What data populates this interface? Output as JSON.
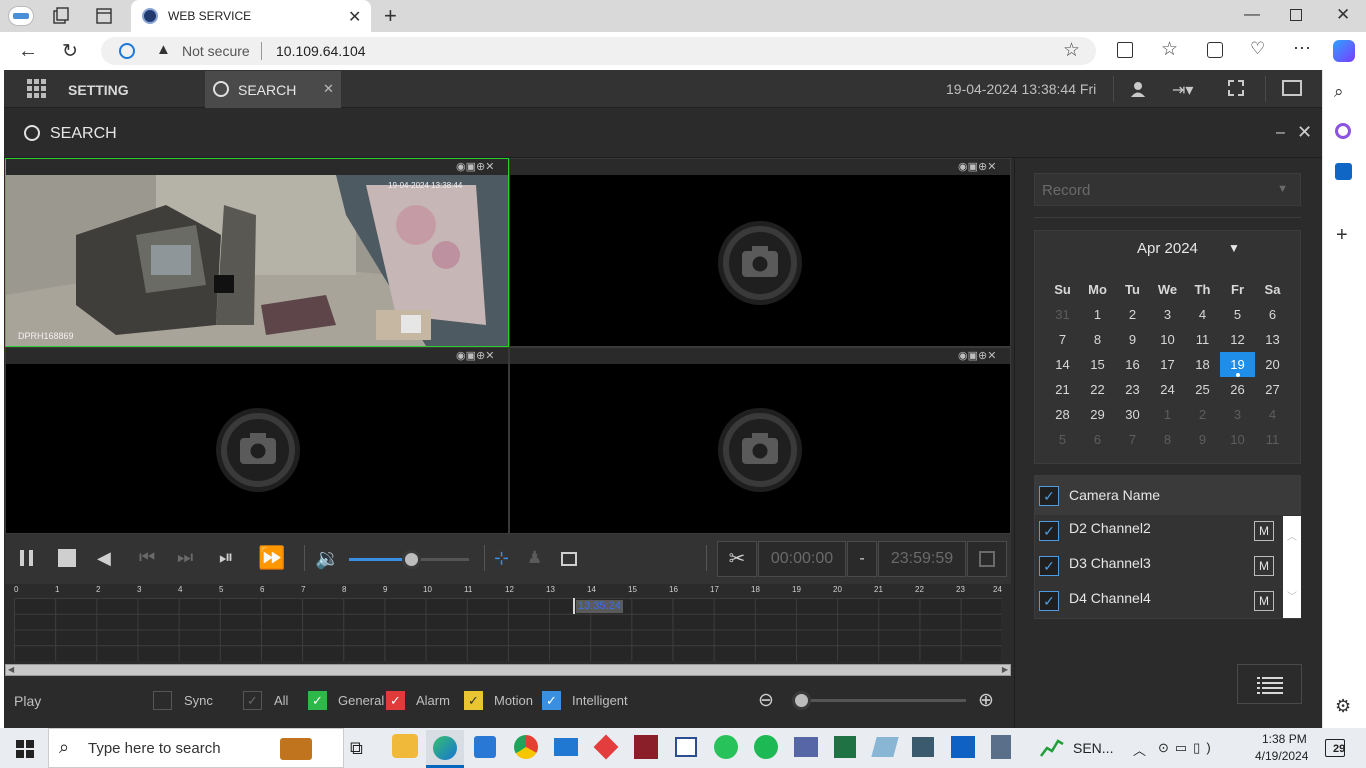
{
  "browser": {
    "tab_title": "WEB SERVICE",
    "not_secure": "Not secure",
    "url": "10.109.64.104"
  },
  "app": {
    "menu_setting": "SETTING",
    "tab_search": "SEARCH",
    "datetime": "19-04-2024 13:38:44 Fri",
    "window_title": "SEARCH"
  },
  "video": {
    "overlay_timestamp": "19-04-2024 13:38:44",
    "overlay_label": "DPRH168869"
  },
  "panel": {
    "record_select": "Record",
    "calendar_month": "Apr 2024",
    "weekdays": [
      "Su",
      "Mo",
      "Tu",
      "We",
      "Th",
      "Fr",
      "Sa"
    ],
    "weeks": [
      [
        "31",
        "1",
        "2",
        "3",
        "4",
        "5",
        "6"
      ],
      [
        "7",
        "8",
        "9",
        "10",
        "11",
        "12",
        "13"
      ],
      [
        "14",
        "15",
        "16",
        "17",
        "18",
        "19",
        "20"
      ],
      [
        "21",
        "22",
        "23",
        "24",
        "25",
        "26",
        "27"
      ],
      [
        "28",
        "29",
        "30",
        "1",
        "2",
        "3",
        "4"
      ],
      [
        "5",
        "6",
        "7",
        "8",
        "9",
        "10",
        "11"
      ]
    ],
    "selected_day": "19",
    "camera_header": "Camera Name",
    "cameras": [
      {
        "name": "D2 Channel2",
        "mode": "M"
      },
      {
        "name": "D3 Channel3",
        "mode": "M"
      },
      {
        "name": "D4 Channel4",
        "mode": "M"
      }
    ]
  },
  "playback": {
    "clip_start": "00:00:00",
    "clip_sep": "-",
    "clip_end": "23:59:59",
    "hours": [
      "0",
      "1",
      "2",
      "3",
      "4",
      "5",
      "6",
      "7",
      "8",
      "9",
      "10",
      "11",
      "12",
      "13",
      "14",
      "15",
      "16",
      "17",
      "18",
      "19",
      "20",
      "21",
      "22",
      "23",
      "24"
    ],
    "cursor_time": "13:35:24",
    "volume_level": 0.5
  },
  "footer": {
    "play_label": "Play",
    "sync": "Sync",
    "all": "All",
    "general": "General",
    "alarm": "Alarm",
    "motion": "Motion",
    "intelligent": "Intelligent",
    "colors": {
      "general": "#2fb84a",
      "alarm": "#e03a3a",
      "motion": "#e8c531",
      "intelligent": "#3a8fe0"
    }
  },
  "taskbar": {
    "search_placeholder": "Type here to search",
    "tray_app": "SEN...",
    "time": "1:38 PM",
    "date": "4/19/2024",
    "notifications": "29"
  }
}
